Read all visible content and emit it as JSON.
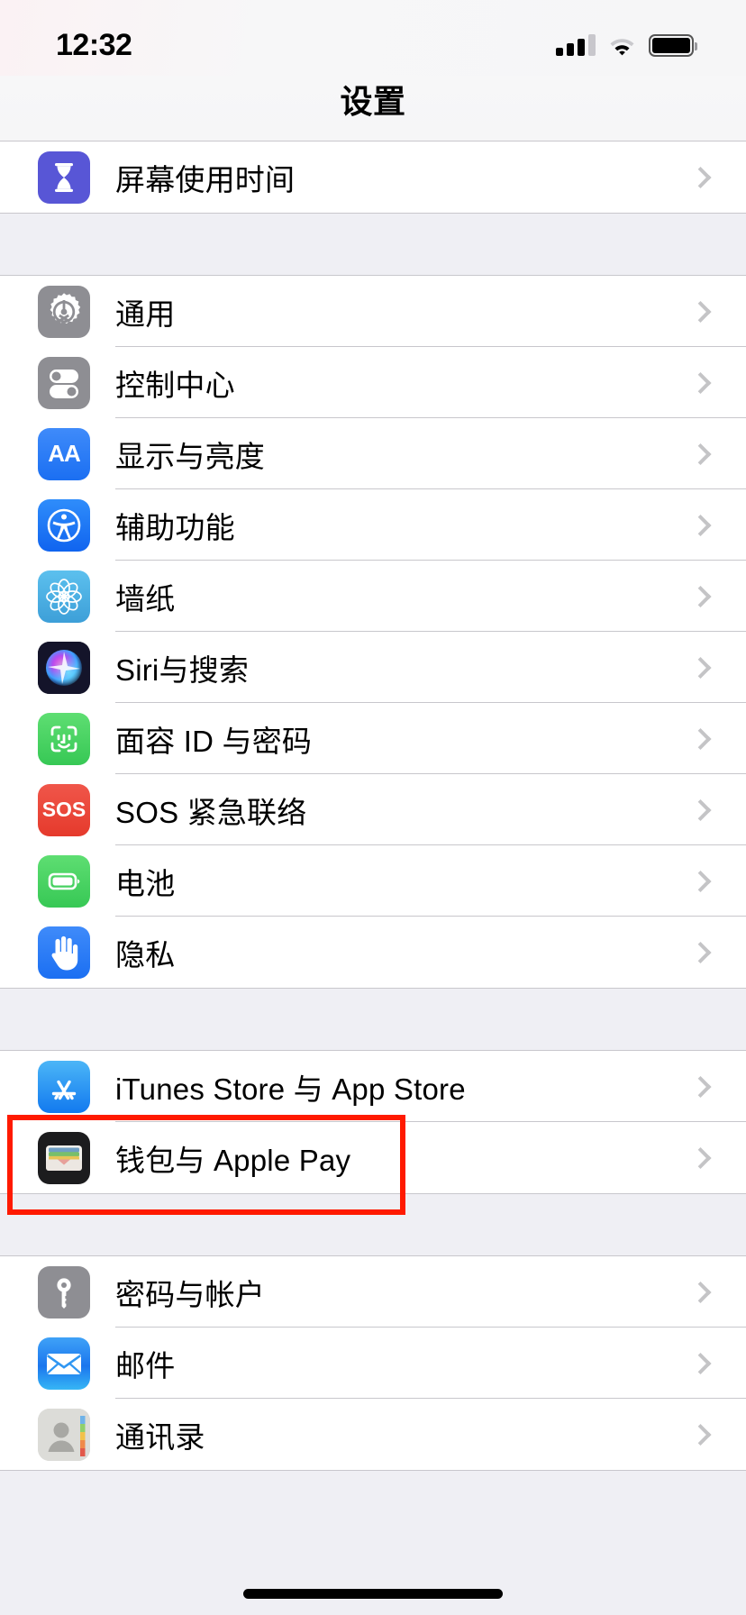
{
  "status_bar": {
    "time": "12:32",
    "signal_icon": "cellular-signal-icon",
    "signal_bars_filled": 3,
    "signal_bars_total": 4,
    "wifi_icon": "wifi-icon",
    "battery_icon": "battery-icon",
    "battery_level_percent": 95
  },
  "nav": {
    "title": "设置"
  },
  "groups": [
    {
      "id": "screen-time-group",
      "rows": [
        {
          "label": "屏幕使用时间",
          "icon": "hourglass-icon",
          "icon_color": "#5856d6",
          "chevron": true
        }
      ]
    },
    {
      "id": "system-group",
      "rows": [
        {
          "label": "通用",
          "icon": "gear-icon",
          "icon_color": "#8e8e93",
          "chevron": true
        },
        {
          "label": "控制中心",
          "icon": "toggles-icon",
          "icon_color": "#8e8e93",
          "chevron": true
        },
        {
          "label": "显示与亮度",
          "icon": "aa-text-icon",
          "icon_color": "#2a7bf6",
          "chevron": true
        },
        {
          "label": "辅助功能",
          "icon": "accessibility-icon",
          "icon_color": "#157efb",
          "chevron": true
        },
        {
          "label": "墙纸",
          "icon": "flower-icon",
          "icon_color": "#4ab0e8",
          "chevron": true
        },
        {
          "label": "Siri与搜索",
          "icon": "siri-icon",
          "icon_color": "#1c1c2b",
          "chevron": true
        },
        {
          "label": "面容 ID 与密码",
          "icon": "face-id-icon",
          "icon_color": "#4cd464",
          "chevron": true
        },
        {
          "label": "SOS 紧急联络",
          "icon": "sos-icon",
          "icon_color": "#eb4b3f",
          "chevron": true
        },
        {
          "label": "电池",
          "icon": "battery-green-icon",
          "icon_color": "#4cd464",
          "chevron": true
        },
        {
          "label": "隐私",
          "icon": "hand-icon",
          "icon_color": "#2a7bf6",
          "chevron": true
        }
      ]
    },
    {
      "id": "store-group",
      "rows": [
        {
          "label": "iTunes Store 与 App Store",
          "icon": "app-store-icon",
          "icon_color": "#2a9cf5",
          "chevron": true
        },
        {
          "label": "钱包与 Apple Pay",
          "icon": "wallet-icon",
          "icon_color": "#1c1c1e",
          "chevron": true,
          "highlighted": true
        }
      ]
    },
    {
      "id": "accounts-group",
      "rows": [
        {
          "label": "密码与帐户",
          "icon": "key-icon",
          "icon_color": "#8e8e93",
          "chevron": true
        },
        {
          "label": "邮件",
          "icon": "mail-icon",
          "icon_color": "#2a9cf5",
          "chevron": true
        },
        {
          "label": "通讯录",
          "icon": "contacts-icon",
          "icon_color": "#d8d8d4",
          "chevron": true
        }
      ]
    }
  ],
  "annotation": {
    "highlight_color": "#ff1a00",
    "highlight_target": "钱包与 Apple Pay"
  },
  "home_indicator": {
    "visible": true
  }
}
